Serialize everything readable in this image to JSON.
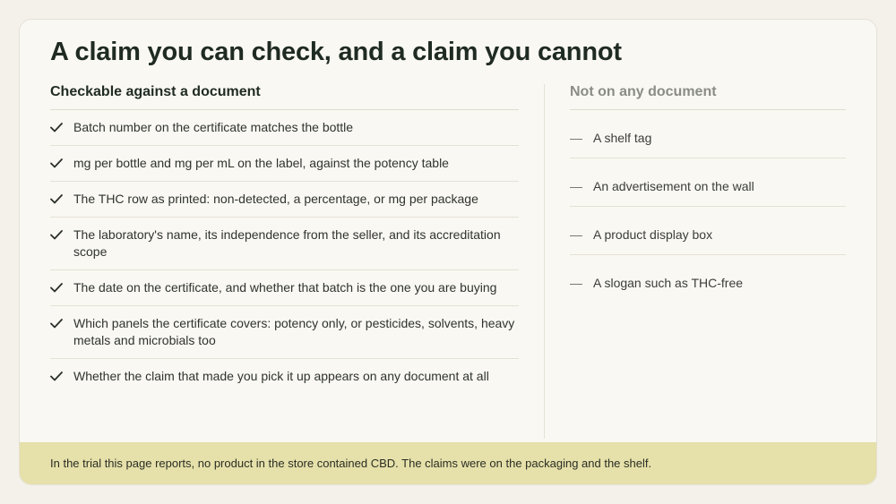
{
  "title": "A claim you can check, and a claim you cannot",
  "checkable": {
    "heading": "Checkable against a document",
    "items": [
      "Batch number on the certificate matches the bottle",
      "mg per bottle and mg per mL on the label, against the potency table",
      "The THC row as printed: non-detected, a percentage, or mg per package",
      "The laboratory's name, its independence from the seller, and its accreditation scope",
      "The date on the certificate, and whether that batch is the one you are buying",
      "Which panels the certificate covers: potency only, or pesticides, solvents, heavy metals and microbials too",
      "Whether the claim that made you pick it up appears on any document at all"
    ]
  },
  "not_on_document": {
    "heading": "Not on any document",
    "dash": "—",
    "items": [
      "A shelf tag",
      "An advertisement on the wall",
      "A product display box",
      "A slogan such as THC-free"
    ]
  },
  "footer": "In the trial this page reports, no product in the store contained CBD. The claims were on the packaging and the shelf.",
  "icons": {
    "check": "check-icon",
    "dash": "dash-icon"
  },
  "colors": {
    "footer_bg": "#e6e0aa",
    "card_bg": "#faf8f2",
    "page_bg": "#f3f1ea"
  }
}
